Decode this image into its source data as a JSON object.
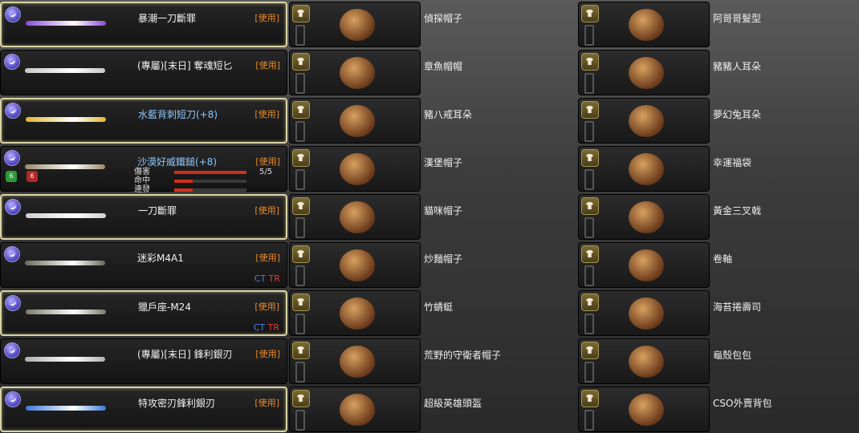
{
  "weapons": [
    {
      "name": "暴潮一刀斷罪",
      "action": "[使用]",
      "gun_color": "#8a4ad8",
      "selected": true
    },
    {
      "name": "(專屬)[末日] 奪魂短匕",
      "action": "[使用]",
      "gun_color": "#c8c8c8",
      "selected": false
    },
    {
      "name": "水藍背刺短刀(+8)",
      "action": "[使用]",
      "gun_color": "#e0b830",
      "selected": true,
      "enhanced": true
    },
    {
      "name": "沙漠好威鐵鎚(+8)",
      "action": "[使用]",
      "gun_color": "#9a8a6a",
      "selected": false,
      "enhanced": true
    },
    {
      "name": "一刀斷罪",
      "action": "[使用]",
      "gun_color": "#d0d0d0",
      "selected": true
    },
    {
      "name": "迷彩M4A1",
      "action": "[使用]",
      "gun_color": "#6a6a5a",
      "selected": false,
      "teams": [
        "CT",
        "TR"
      ]
    },
    {
      "name": "獵戶座-M24",
      "action": "[使用]",
      "gun_color": "#7a7a6a",
      "selected": true,
      "teams": [
        "CT",
        "TR"
      ]
    },
    {
      "name": "(專屬)[末日] 鋒利銀刃",
      "action": "[使用]",
      "gun_color": "#b0b0b0",
      "selected": false
    },
    {
      "name": "特攻密刃鋒利銀刃",
      "action": "[使用]",
      "gun_color": "#3a7ad8",
      "selected": true
    }
  ],
  "weapon_stats": {
    "labels": [
      "傷害",
      "命中",
      "連發"
    ],
    "damage_value": "5/5",
    "damage_level": 1.0,
    "accuracy_level": 0.25,
    "rate_level": 0.25
  },
  "stat_badges": [
    "6",
    "6"
  ],
  "items_col2": [
    {
      "name": "偵探帽子",
      "icon": "detective-hat-icon"
    },
    {
      "name": "章魚帽帽",
      "icon": "octopus-hat-icon"
    },
    {
      "name": "豬八戒耳朵",
      "icon": "pig-ears-icon"
    },
    {
      "name": "漢堡帽子",
      "icon": "burger-hat-icon"
    },
    {
      "name": "貓咪帽子",
      "icon": "cat-hat-icon"
    },
    {
      "name": "炒麵帽子",
      "icon": "noodle-hat-icon"
    },
    {
      "name": "竹蜻蜓",
      "icon": "propeller-hat-icon"
    },
    {
      "name": "荒野的守衛者帽子",
      "icon": "sheriff-hat-icon"
    },
    {
      "name": "超級英雄頭盔",
      "icon": "hero-helmet-icon"
    }
  ],
  "items_col3": [
    {
      "name": "阿哥哥髮型",
      "icon": "afro-hair-icon"
    },
    {
      "name": "豬豬人耳朵",
      "icon": "pink-ears-icon"
    },
    {
      "name": "夢幻兔耳朵",
      "icon": "bunny-ears-icon"
    },
    {
      "name": "幸運福袋",
      "icon": "lucky-bag-icon"
    },
    {
      "name": "黃金三叉戟",
      "icon": "golden-trident-icon"
    },
    {
      "name": "卷軸",
      "icon": "scroll-icon"
    },
    {
      "name": "海苔捲壽司",
      "icon": "sushi-icon"
    },
    {
      "name": "龜殼包包",
      "icon": "turtle-shell-icon"
    },
    {
      "name": "CSO外賣背包",
      "icon": "delivery-box-icon"
    }
  ]
}
